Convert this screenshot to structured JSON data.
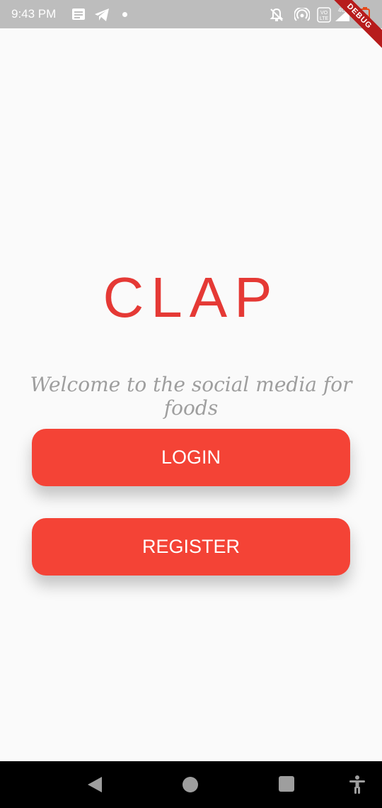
{
  "status_bar": {
    "time": "9:43 PM",
    "icons": [
      "notification-icon",
      "telegram-icon",
      "dot-icon",
      "mute-icon",
      "hotspot-icon",
      "volte-icon",
      "signal-icon",
      "battery-icon"
    ],
    "debug_ribbon": "DEBUG"
  },
  "main": {
    "title": "CLAP",
    "tagline": "Welcome to the social media for foods",
    "login_label": "LOGIN",
    "register_label": "REGISTER"
  },
  "nav_bar": {
    "icons": [
      "back-icon",
      "home-icon",
      "recents-icon",
      "accessibility-icon"
    ]
  },
  "colors": {
    "accent": "#f44336",
    "title": "#e53935",
    "tagline": "#9e9e9e",
    "status_bar": "#bdbdbd",
    "background": "#fafafa"
  }
}
